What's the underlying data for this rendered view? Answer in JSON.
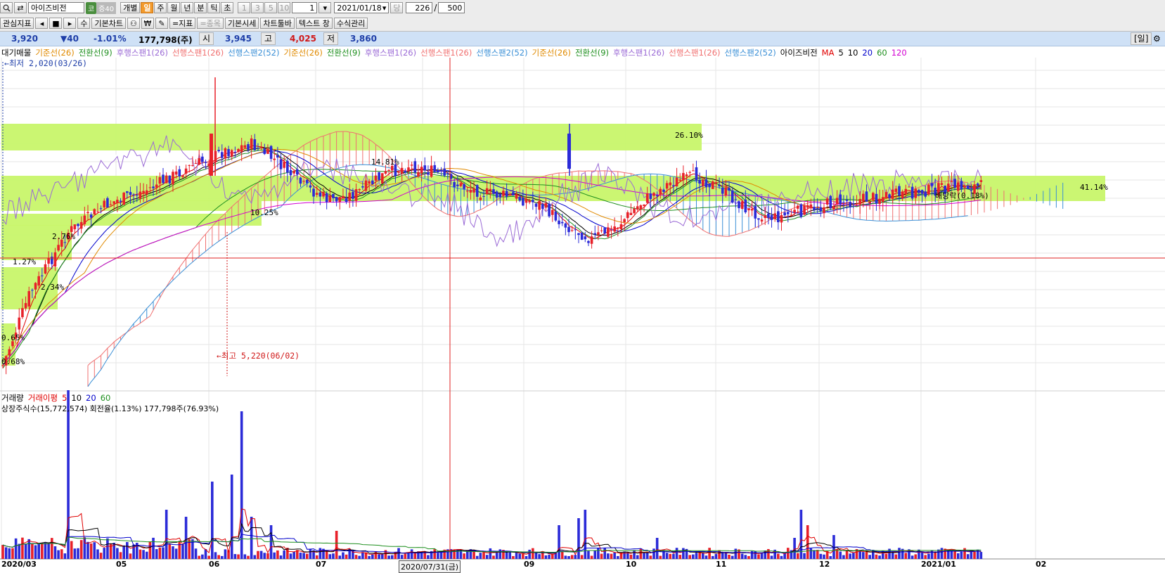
{
  "toolbar1": {
    "stock_name": "아이즈비전",
    "market_badge": "코",
    "group_badge": "증40",
    "periods": [
      "개별",
      "일",
      "주",
      "월",
      "년",
      "분",
      "틱",
      "초"
    ],
    "active_period": "일",
    "intervals": [
      "1",
      "3",
      "5",
      "10"
    ],
    "interval_value": "1",
    "date": "2021/01/18",
    "date_btn": "당",
    "count_shown": "226",
    "count_sep": "/",
    "count_total": "500"
  },
  "toolbar2": {
    "interest_label": "관심지표",
    "nav_glyphs": [
      "◂",
      "■",
      "▸"
    ],
    "su_label": "수",
    "basic_chart": "기본차트",
    "won_icon_text": "₩",
    "indicator_btn": "=지표",
    "item_btn": "=종목",
    "basic_quote": "기본시세",
    "chart_toolbar": "차트툴바",
    "text_window": "텍스트 창",
    "formula_mgmt": "수식관리"
  },
  "quote": {
    "price": "3,920",
    "change": "▼40",
    "change_pct": "-1.01%",
    "volume": "177,798(주)",
    "open_label": "시",
    "open": "3,945",
    "high_label": "고",
    "high": "4,025",
    "low_label": "저",
    "low": "3,860",
    "period_label": "[일]"
  },
  "legend_price": [
    {
      "text": "대기매물",
      "color": "#000000"
    },
    {
      "text": "기준선(26)",
      "color": "#e08a00"
    },
    {
      "text": "전환선(9)",
      "color": "#1e8f1e"
    },
    {
      "text": "후행스팬1(26)",
      "color": "#9b6bd6"
    },
    {
      "text": "선행스팬1(26)",
      "color": "#f07070"
    },
    {
      "text": "선행스팬2(52)",
      "color": "#3a8fd6"
    },
    {
      "text": "기준선(26)",
      "color": "#e08a00"
    },
    {
      "text": "전환선(9)",
      "color": "#1e8f1e"
    },
    {
      "text": "후행스팬1(26)",
      "color": "#9b6bd6"
    },
    {
      "text": "선행스팬1(26)",
      "color": "#f07070"
    },
    {
      "text": "선행스팬2(52)",
      "color": "#3a8fd6"
    },
    {
      "text": "기준선(26)",
      "color": "#e08a00"
    },
    {
      "text": "전환선(9)",
      "color": "#1e8f1e"
    },
    {
      "text": "후행스팬1(26)",
      "color": "#9b6bd6"
    },
    {
      "text": "선행스팬1(26)",
      "color": "#f07070"
    },
    {
      "text": "선행스팬2(52)",
      "color": "#3a8fd6"
    },
    {
      "text": "아이즈비전",
      "color": "#000000"
    },
    {
      "text": "MA",
      "color": "#e00000"
    },
    {
      "text": "5",
      "color": "#000000"
    },
    {
      "text": "10",
      "color": "#000000"
    },
    {
      "text": "20",
      "color": "#0000cc"
    },
    {
      "text": "60",
      "color": "#1e8f1e"
    },
    {
      "text": "120",
      "color": "#d200d2"
    }
  ],
  "annotations": {
    "low": "←최저 2,020(03/26)",
    "high": "←최고 5,220(06/02)"
  },
  "profile_pcts": [
    "26.10%",
    "41.14%",
    "10.25%",
    "14.81%",
    "2.76%",
    "1.27%",
    "2.34%",
    "0.65%",
    "0.68%",
    "배당락(0.18%)"
  ],
  "legend_volume": [
    {
      "text": "거래량",
      "color": "#000000"
    },
    {
      "text": "거래이평",
      "color": "#e00000"
    },
    {
      "text": "5",
      "color": "#e00000"
    },
    {
      "text": "10",
      "color": "#000000"
    },
    {
      "text": "20",
      "color": "#0000cc"
    },
    {
      "text": "60",
      "color": "#1e8f1e"
    }
  ],
  "volume_info": "상장주식수(15,772,574) 회전율(1.13%) 177,798주(76.93%)",
  "x_axis": [
    "2020/03",
    "05",
    "06",
    "07",
    "2020/07/31(금)",
    "09",
    "10",
    "11",
    "12",
    "2021/01",
    "02"
  ],
  "colors": {
    "up": "#e8212a",
    "down": "#2b2bd8",
    "cloud_zone": "#c8f56a",
    "crosshair": "#e02020"
  },
  "chart_data": {
    "type": "candlestick",
    "title": "아이즈비전",
    "ylim": [
      1900,
      5300
    ],
    "annotated_low": {
      "date": "2020/03/26",
      "value": 2020
    },
    "annotated_high": {
      "date": "2020/06/02",
      "value": 5220
    },
    "last": {
      "date": "2021/01/18",
      "open": 3945,
      "high": 4025,
      "low": 3860,
      "close": 3920,
      "volume": 177798
    }
  }
}
